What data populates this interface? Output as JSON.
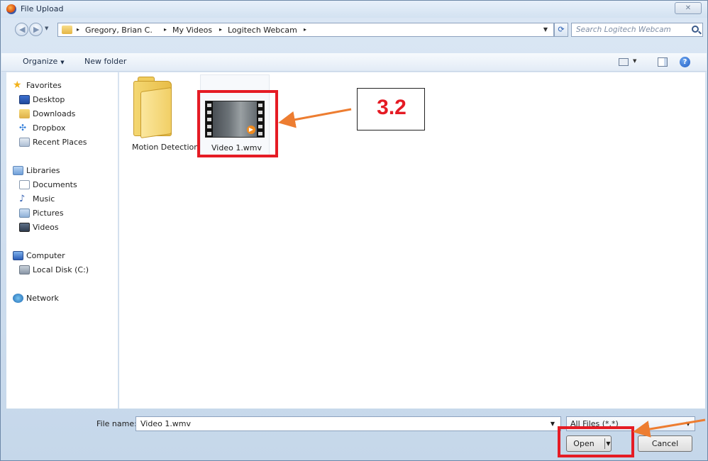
{
  "window": {
    "title": "File Upload",
    "close_symbol": "✕"
  },
  "address": {
    "segments": [
      "Gregory, Brian C.",
      "My Videos",
      "Logitech Webcam"
    ],
    "separator": "▸",
    "search_placeholder": "Search Logitech Webcam"
  },
  "toolbar": {
    "organize_label": "Organize",
    "new_folder_label": "New folder",
    "help_label": "?"
  },
  "nav": {
    "favorites": {
      "header": "Favorites",
      "items": [
        "Desktop",
        "Downloads",
        "Dropbox",
        "Recent Places"
      ]
    },
    "libraries": {
      "header": "Libraries",
      "items": [
        "Documents",
        "Music",
        "Pictures",
        "Videos"
      ]
    },
    "computer": {
      "header": "Computer",
      "items": [
        "Local Disk (C:)"
      ]
    },
    "network": {
      "header": "Network"
    }
  },
  "files": [
    {
      "name": "Motion Detection",
      "kind": "folder"
    },
    {
      "name": "Video 1.wmv",
      "kind": "video",
      "selected": true
    }
  ],
  "annotation": {
    "step_label": "3.2",
    "color": "#e51b24",
    "arrow_color": "#ed7d31"
  },
  "footer": {
    "file_name_label": "File name:",
    "file_name_value": "Video 1.wmv",
    "file_type_value": "All Files (*.*)",
    "open_label": "Open",
    "cancel_label": "Cancel"
  }
}
